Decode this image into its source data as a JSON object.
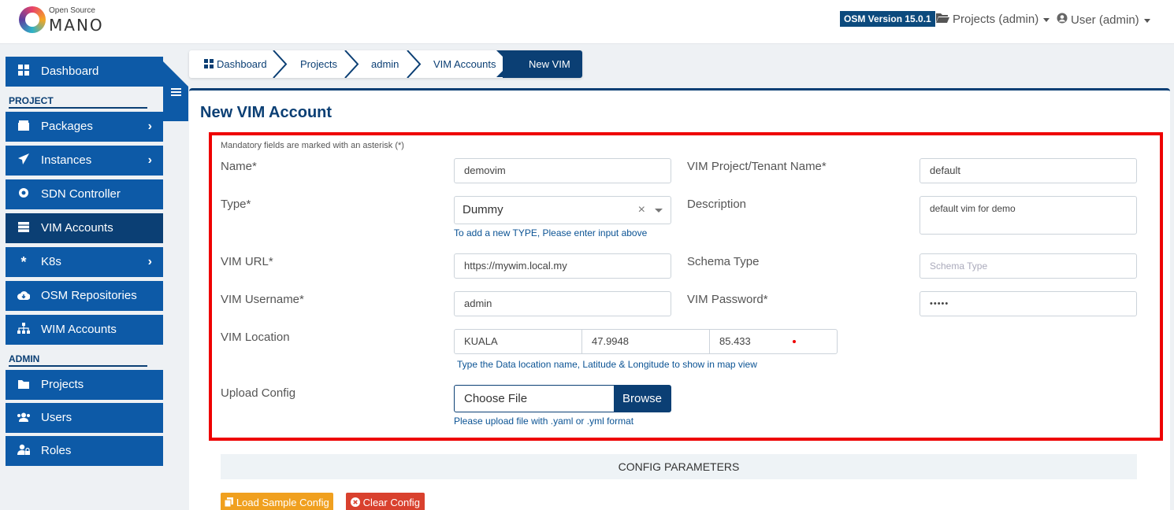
{
  "header": {
    "logo_top": "Open Source",
    "logo_bottom": "MANO",
    "version": "OSM Version 15.0.1",
    "projects_menu": "Projects (admin)",
    "user_menu": "User (admin)"
  },
  "sidebar": {
    "project_heading": "PROJECT",
    "admin_heading": "ADMIN",
    "items": [
      {
        "label": "Dashboard",
        "icon": "dashboard-icon"
      },
      {
        "label": "Packages",
        "icon": "package-icon"
      },
      {
        "label": "Instances",
        "icon": "paper-plane-icon"
      },
      {
        "label": "SDN Controller",
        "icon": "sdn-icon"
      },
      {
        "label": "VIM Accounts",
        "icon": "server-icon"
      },
      {
        "label": "K8s",
        "icon": "asterisk-icon"
      },
      {
        "label": "OSM Repositories",
        "icon": "cloud-download-icon"
      },
      {
        "label": "WIM Accounts",
        "icon": "sitemap-icon"
      },
      {
        "label": "Projects",
        "icon": "folder-icon"
      },
      {
        "label": "Users",
        "icon": "users-icon"
      },
      {
        "label": "Roles",
        "icon": "user-lock-icon"
      }
    ]
  },
  "breadcrumb": [
    "Dashboard",
    "Projects",
    "admin",
    "VIM Accounts",
    "New VIM"
  ],
  "page": {
    "title": "New VIM Account",
    "mandatory_note": "Mandatory fields are marked with an asterisk (*)"
  },
  "form": {
    "name_label": "Name*",
    "name_value": "demovim",
    "tenant_label": "VIM Project/Tenant Name*",
    "tenant_value": "default",
    "type_label": "Type*",
    "type_value": "Dummy",
    "type_hint": "To add a new TYPE, Please enter input above",
    "description_label": "Description",
    "description_value": "default vim for demo",
    "url_label": "VIM URL*",
    "url_value": "https://mywim.local.my",
    "schema_label": "Schema Type",
    "schema_placeholder": "Schema Type",
    "username_label": "VIM Username*",
    "username_value": "admin",
    "password_label": "VIM Password*",
    "password_value": "•••••",
    "location_label": "VIM Location",
    "location_name": "KUALA",
    "latitude": "47.9948",
    "longitude": "85.433",
    "location_hint": "Type the Data location name, Latitude & Longitude to show in map view",
    "upload_label": "Upload Config",
    "file_placeholder": "Choose File",
    "browse_label": "Browse",
    "upload_hint": "Please upload file with .yaml or .yml format"
  },
  "config": {
    "section_title": "CONFIG PARAMETERS",
    "load_sample_label": "Load Sample Config",
    "clear_label": "Clear Config"
  },
  "colors": {
    "primary": "#0b3f74",
    "sidebar": "#0d5aa7",
    "highlight_box": "#e00000",
    "warning": "#f0a01f",
    "danger": "#d9412e"
  }
}
